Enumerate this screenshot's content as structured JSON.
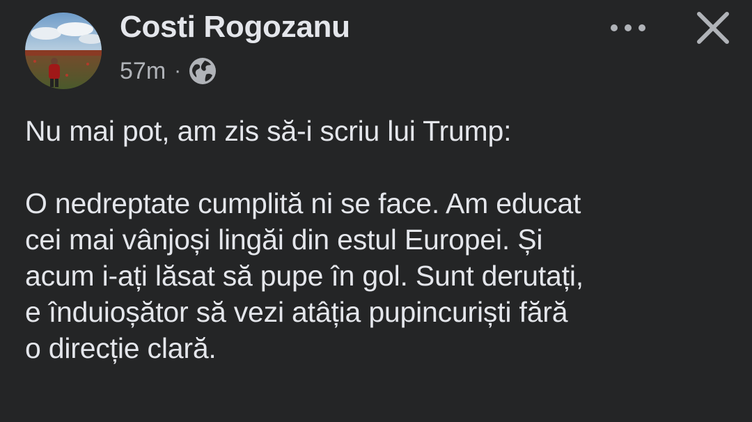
{
  "post": {
    "author": "Costi Rogozanu",
    "time": "57m",
    "separator": "·",
    "privacy_icon": "globe-icon",
    "more_icon": "more-horizontal-icon",
    "close_icon": "close-icon",
    "body_intro": "Nu mai pot, am zis să-i scriu lui Trump:",
    "body_lines": [
      "O nedreptate cumplită ni se face. Am educat",
      "cei mai vânjoși lingăi din estul Europei. Și",
      "acum i-ați lăsat să pupe în gol. Sunt derutați,",
      "e înduioșător să vezi atâția pupincuriști fără",
      "o direcție clară."
    ]
  },
  "colors": {
    "background": "#242526",
    "primary_text": "#e4e6eb",
    "secondary_text": "#b0b3b8"
  }
}
